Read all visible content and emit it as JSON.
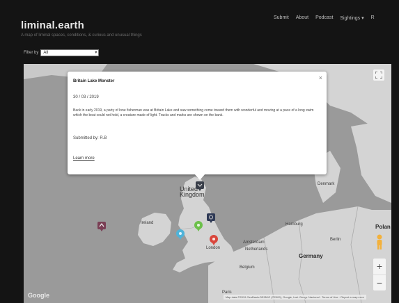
{
  "site": {
    "title": "liminal.earth",
    "tagline": "A map of liminal spaces, conditions, & curious and unusual things"
  },
  "nav": {
    "items": [
      "Submit",
      "About",
      "Podcast",
      "Sightings ▾",
      "R"
    ]
  },
  "filter": {
    "label": "Filter by",
    "selected": "All"
  },
  "map": {
    "labels": {
      "united_kingdom": "United\nKingdom",
      "ireland": "Ireland",
      "netherlands": "Netherlands",
      "belgium": "Belgium",
      "germany": "Germany",
      "poland": "Polan",
      "berlin": "Berlin",
      "hamburg": "Hamburg",
      "london": "London",
      "amsterdam": "Amsterdam",
      "paris": "Paris",
      "denmark": "Denmark"
    },
    "google": "Google",
    "attribution": "Map data ©2019 GeoBasis-DE/BKG (©2009), Google, Inst. Geogr. Nacional · Terms of Use · Report a map error"
  },
  "info_window": {
    "title": "Britain Lake Monster",
    "date": "30 / 03 / 2019",
    "description": "Back in early 2019, a party of lone fisherman was at Britain Lake and saw something come toward them with wonderful and moving at a pace of a long swim which the boat could not hold, a creature made of light. Tracks and marks are shown on the bank.",
    "submitted": "Submitted by: R.B",
    "link": "Learn more"
  },
  "colors": {
    "background": "#141414",
    "map_land": "#d4d4d4",
    "map_water": "#9a9a9a",
    "marker_green": "#6cc04a",
    "marker_blue": "#4fb3d9",
    "marker_red": "#d9463c",
    "marker_dark": "#3a3f4a",
    "marker_navy": "#2f3a56",
    "marker_purple": "#7a3f55",
    "pegman": "#f3b13c"
  }
}
